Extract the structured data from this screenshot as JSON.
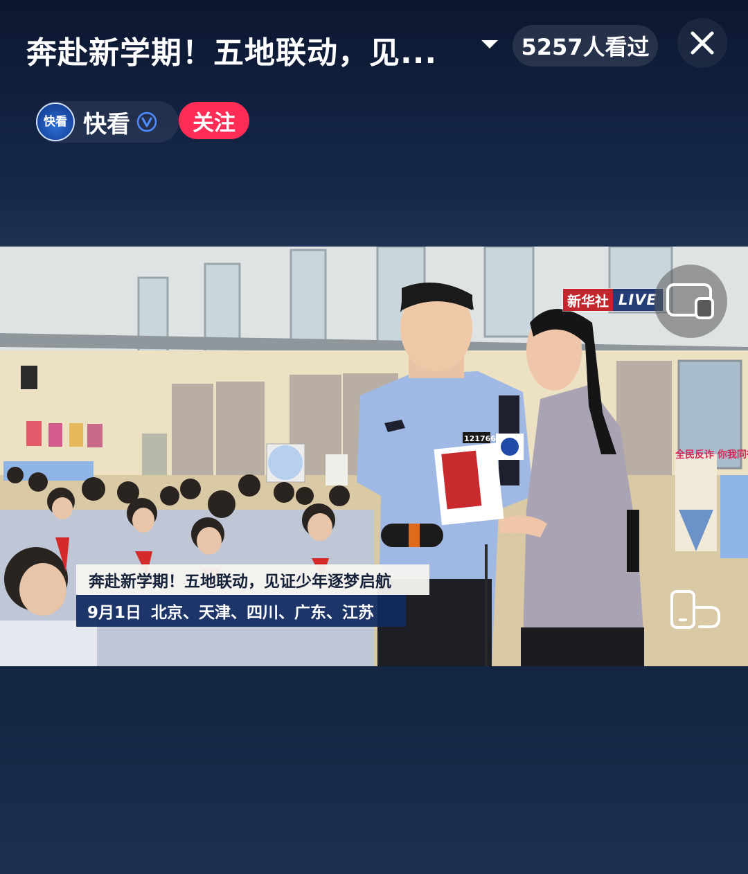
{
  "header": {
    "title": "奔赴新学期！五地联动，见...",
    "viewers": "5257人看过"
  },
  "channel": {
    "avatar_text": "快看",
    "name": "快看",
    "follow_label": "关注"
  },
  "video": {
    "badge_brand": "新华社",
    "badge_live": "LIVE",
    "caption_title": "奔赴新学期！五地联动，见证少年逐梦启航",
    "caption_date": "9月1日",
    "caption_places": "北京、天津、四川、广东、江苏",
    "officer_badge": "121766",
    "wall_sign": "全民反诈 你我同行"
  },
  "icons": [
    "dropdown-arrow-icon",
    "close-icon",
    "verified-icon",
    "picture-in-picture-icon",
    "rotate-screen-icon"
  ],
  "colors": {
    "follow": "#ff2d55",
    "caption_bar": "#102a60",
    "badge_red": "#c4262e",
    "background": "#142541"
  }
}
